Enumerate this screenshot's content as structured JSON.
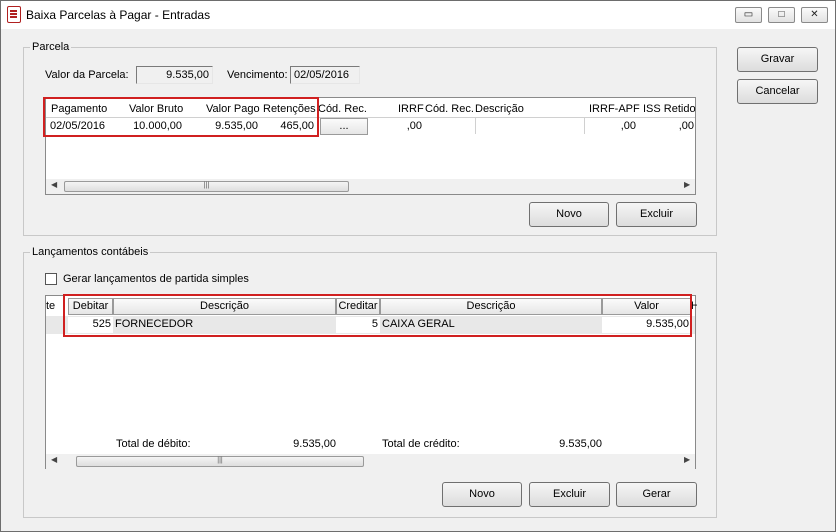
{
  "window": {
    "title": "Baixa Parcelas à Pagar - Entradas",
    "minimize_glyph": "▭",
    "maximize_glyph": "□",
    "close_glyph": "✕"
  },
  "actions": {
    "gravar": "Gravar",
    "cancelar": "Cancelar"
  },
  "parcela": {
    "group_label": "Parcela",
    "valor_label": "Valor da Parcela:",
    "valor_value": "9.535,00",
    "vencimento_label": "Vencimento:",
    "vencimento_value": "02/05/2016",
    "columns": [
      "Pagamento",
      "Valor Bruto",
      "Valor Pago",
      "Retenções",
      "Cód. Rec.",
      "IRRF",
      "Cód. Rec.",
      "Descrição",
      "IRRF-APF",
      "ISS Retido"
    ],
    "row": {
      "pagamento": "02/05/2016",
      "valor_bruto": "10.000,00",
      "valor_pago": "9.535,00",
      "retencoes": "465,00",
      "cod_rec_button": "...",
      "irrf": ",00",
      "irrf_apf": ",00",
      "iss_retido": ",00"
    },
    "novo": "Novo",
    "excluir": "Excluir"
  },
  "lancamentos": {
    "group_label": "Lançamentos contábeis",
    "checkbox_label": "Gerar lançamentos de partida simples",
    "checkbox_checked": false,
    "columns": [
      "te",
      "Debitar",
      "Descrição",
      "Creditar",
      "Descrição",
      "Valor",
      "H"
    ],
    "row": {
      "debitar": "525",
      "descricao_debito": "FORNECEDOR",
      "creditar": "5",
      "descricao_credito": "CAIXA GERAL",
      "valor": "9.535,00"
    },
    "total_debito_label": "Total de débito:",
    "total_debito_value": "9.535,00",
    "total_credito_label": "Total de crédito:",
    "total_credito_value": "9.535,00",
    "novo": "Novo",
    "excluir": "Excluir",
    "gerar": "Gerar"
  },
  "scrollbar": {
    "left_arrow": "◀",
    "right_arrow": "▶",
    "grip": "|||"
  }
}
